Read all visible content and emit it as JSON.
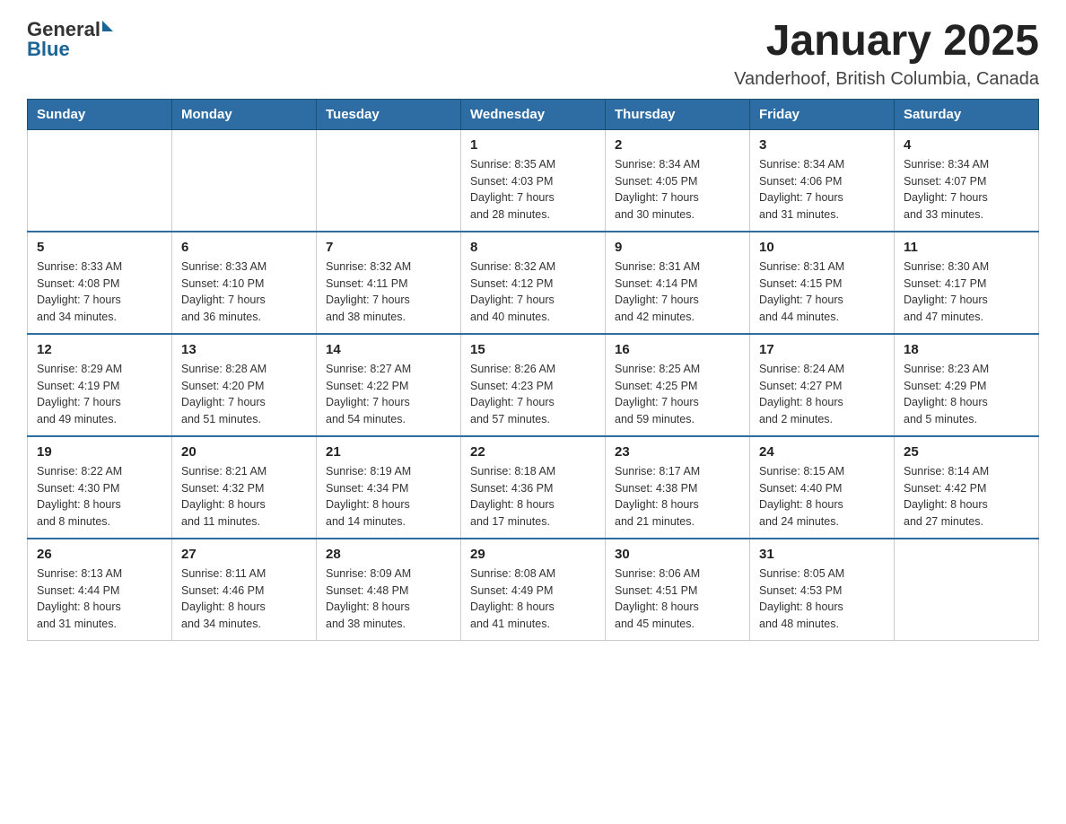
{
  "header": {
    "logo": {
      "general": "General",
      "blue": "Blue"
    },
    "title": "January 2025",
    "location": "Vanderhoof, British Columbia, Canada"
  },
  "calendar": {
    "days_of_week": [
      "Sunday",
      "Monday",
      "Tuesday",
      "Wednesday",
      "Thursday",
      "Friday",
      "Saturday"
    ],
    "weeks": [
      [
        {
          "day": "",
          "info": ""
        },
        {
          "day": "",
          "info": ""
        },
        {
          "day": "",
          "info": ""
        },
        {
          "day": "1",
          "info": "Sunrise: 8:35 AM\nSunset: 4:03 PM\nDaylight: 7 hours\nand 28 minutes."
        },
        {
          "day": "2",
          "info": "Sunrise: 8:34 AM\nSunset: 4:05 PM\nDaylight: 7 hours\nand 30 minutes."
        },
        {
          "day": "3",
          "info": "Sunrise: 8:34 AM\nSunset: 4:06 PM\nDaylight: 7 hours\nand 31 minutes."
        },
        {
          "day": "4",
          "info": "Sunrise: 8:34 AM\nSunset: 4:07 PM\nDaylight: 7 hours\nand 33 minutes."
        }
      ],
      [
        {
          "day": "5",
          "info": "Sunrise: 8:33 AM\nSunset: 4:08 PM\nDaylight: 7 hours\nand 34 minutes."
        },
        {
          "day": "6",
          "info": "Sunrise: 8:33 AM\nSunset: 4:10 PM\nDaylight: 7 hours\nand 36 minutes."
        },
        {
          "day": "7",
          "info": "Sunrise: 8:32 AM\nSunset: 4:11 PM\nDaylight: 7 hours\nand 38 minutes."
        },
        {
          "day": "8",
          "info": "Sunrise: 8:32 AM\nSunset: 4:12 PM\nDaylight: 7 hours\nand 40 minutes."
        },
        {
          "day": "9",
          "info": "Sunrise: 8:31 AM\nSunset: 4:14 PM\nDaylight: 7 hours\nand 42 minutes."
        },
        {
          "day": "10",
          "info": "Sunrise: 8:31 AM\nSunset: 4:15 PM\nDaylight: 7 hours\nand 44 minutes."
        },
        {
          "day": "11",
          "info": "Sunrise: 8:30 AM\nSunset: 4:17 PM\nDaylight: 7 hours\nand 47 minutes."
        }
      ],
      [
        {
          "day": "12",
          "info": "Sunrise: 8:29 AM\nSunset: 4:19 PM\nDaylight: 7 hours\nand 49 minutes."
        },
        {
          "day": "13",
          "info": "Sunrise: 8:28 AM\nSunset: 4:20 PM\nDaylight: 7 hours\nand 51 minutes."
        },
        {
          "day": "14",
          "info": "Sunrise: 8:27 AM\nSunset: 4:22 PM\nDaylight: 7 hours\nand 54 minutes."
        },
        {
          "day": "15",
          "info": "Sunrise: 8:26 AM\nSunset: 4:23 PM\nDaylight: 7 hours\nand 57 minutes."
        },
        {
          "day": "16",
          "info": "Sunrise: 8:25 AM\nSunset: 4:25 PM\nDaylight: 7 hours\nand 59 minutes."
        },
        {
          "day": "17",
          "info": "Sunrise: 8:24 AM\nSunset: 4:27 PM\nDaylight: 8 hours\nand 2 minutes."
        },
        {
          "day": "18",
          "info": "Sunrise: 8:23 AM\nSunset: 4:29 PM\nDaylight: 8 hours\nand 5 minutes."
        }
      ],
      [
        {
          "day": "19",
          "info": "Sunrise: 8:22 AM\nSunset: 4:30 PM\nDaylight: 8 hours\nand 8 minutes."
        },
        {
          "day": "20",
          "info": "Sunrise: 8:21 AM\nSunset: 4:32 PM\nDaylight: 8 hours\nand 11 minutes."
        },
        {
          "day": "21",
          "info": "Sunrise: 8:19 AM\nSunset: 4:34 PM\nDaylight: 8 hours\nand 14 minutes."
        },
        {
          "day": "22",
          "info": "Sunrise: 8:18 AM\nSunset: 4:36 PM\nDaylight: 8 hours\nand 17 minutes."
        },
        {
          "day": "23",
          "info": "Sunrise: 8:17 AM\nSunset: 4:38 PM\nDaylight: 8 hours\nand 21 minutes."
        },
        {
          "day": "24",
          "info": "Sunrise: 8:15 AM\nSunset: 4:40 PM\nDaylight: 8 hours\nand 24 minutes."
        },
        {
          "day": "25",
          "info": "Sunrise: 8:14 AM\nSunset: 4:42 PM\nDaylight: 8 hours\nand 27 minutes."
        }
      ],
      [
        {
          "day": "26",
          "info": "Sunrise: 8:13 AM\nSunset: 4:44 PM\nDaylight: 8 hours\nand 31 minutes."
        },
        {
          "day": "27",
          "info": "Sunrise: 8:11 AM\nSunset: 4:46 PM\nDaylight: 8 hours\nand 34 minutes."
        },
        {
          "day": "28",
          "info": "Sunrise: 8:09 AM\nSunset: 4:48 PM\nDaylight: 8 hours\nand 38 minutes."
        },
        {
          "day": "29",
          "info": "Sunrise: 8:08 AM\nSunset: 4:49 PM\nDaylight: 8 hours\nand 41 minutes."
        },
        {
          "day": "30",
          "info": "Sunrise: 8:06 AM\nSunset: 4:51 PM\nDaylight: 8 hours\nand 45 minutes."
        },
        {
          "day": "31",
          "info": "Sunrise: 8:05 AM\nSunset: 4:53 PM\nDaylight: 8 hours\nand 48 minutes."
        },
        {
          "day": "",
          "info": ""
        }
      ]
    ]
  }
}
